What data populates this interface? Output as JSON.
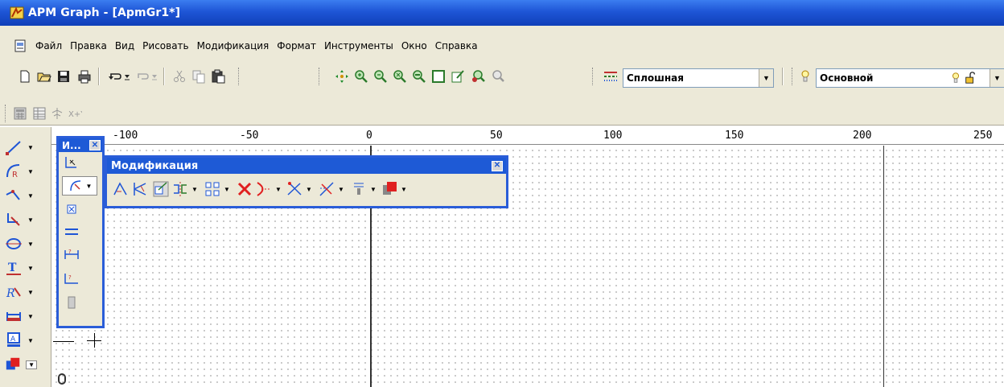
{
  "window": {
    "title": "APM Graph - [ApmGr1*]",
    "title_bar_color": "#1e55d6"
  },
  "menu": {
    "items": [
      "Файл",
      "Правка",
      "Вид",
      "Рисовать",
      "Модификация",
      "Формат",
      "Инструменты",
      "Окно",
      "Справка"
    ]
  },
  "toolbar": {
    "line_type": {
      "value": "Сплошная"
    },
    "layer": {
      "value": "Основной"
    }
  },
  "ruler": {
    "labels": [
      "-100",
      "-50",
      "0",
      "50",
      "100",
      "150",
      "200",
      "250"
    ]
  },
  "panels": {
    "tools_panel": {
      "title": "И..."
    },
    "modify_panel": {
      "title": "Модификация"
    }
  },
  "icons": {
    "toolbar": [
      "new-file-icon",
      "open-folder-icon",
      "save-icon",
      "print-icon",
      "undo-icon",
      "redo-icon",
      "cut-icon",
      "copy-icon",
      "paste-icon",
      "pan-icon",
      "zoom-in-icon",
      "zoom-out-icon",
      "zoom-window-icon",
      "zoom-previous-icon",
      "zoom-extents-icon",
      "properties-icon",
      "zoom-realtime-icon",
      "zoom-dynamic-icon"
    ],
    "accent_red": "#e02020",
    "accent_blue": "#1e55d6"
  }
}
